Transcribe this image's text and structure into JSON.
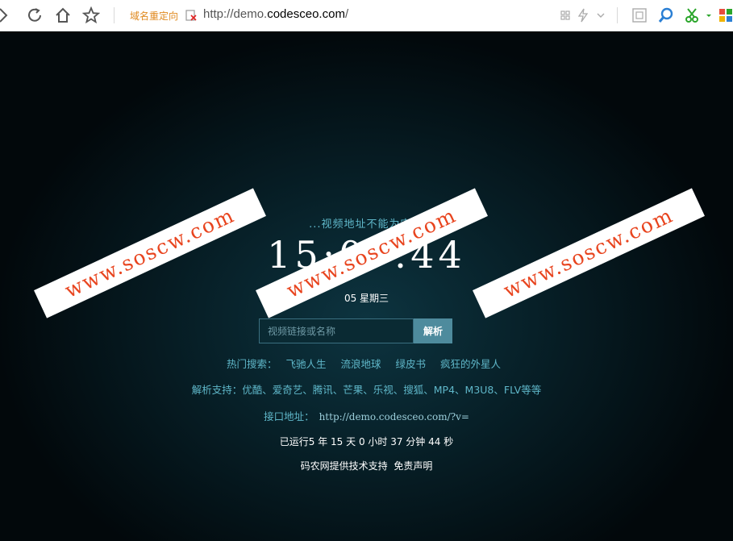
{
  "browser": {
    "redirect_label": "域名重定向",
    "url_prefix": "http://demo.",
    "url_host": "codesceo.com",
    "url_suffix": "/"
  },
  "page": {
    "tip": "...视频地址不能为空...",
    "clock": "15:07:44",
    "date": "05 星期三",
    "search": {
      "placeholder": "视频链接或名称",
      "button_label": "解析"
    },
    "hot": {
      "label": "热门搜索：",
      "items": [
        "飞驰人生",
        "流浪地球",
        "绿皮书",
        "疯狂的外星人"
      ]
    },
    "support": "解析支持：优酷、爱奇艺、腾讯、芒果、乐视、搜狐、MP4、M3U8、FLV等等",
    "api": {
      "label": "接口地址：",
      "address": "http://demo.codesceo.com/?v="
    },
    "runtime": "已运行5 年 15 天 0 小时 37 分钟 44 秒",
    "footer": {
      "support_text": "码农网提供技术支持",
      "disclaimer": "免责声明"
    }
  },
  "watermark": "www.soscw.com"
}
